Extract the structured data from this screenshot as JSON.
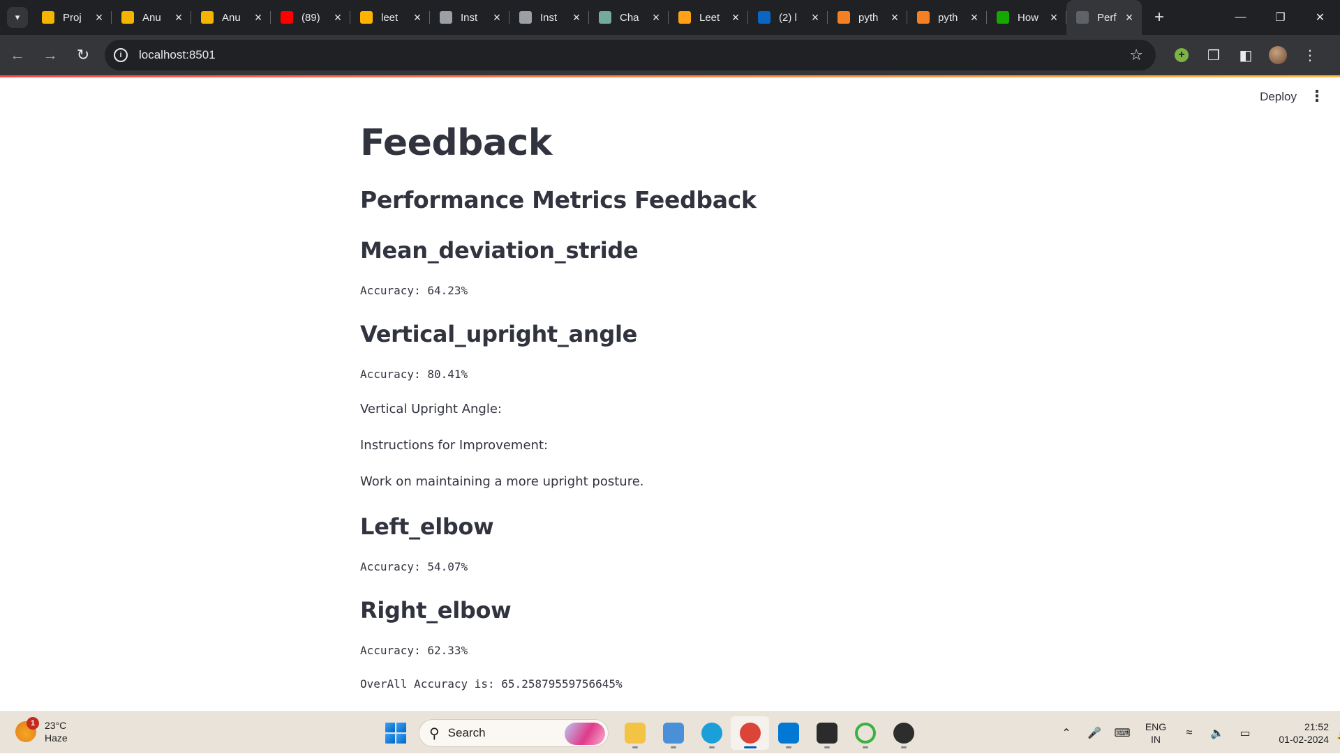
{
  "browser": {
    "tabs": [
      {
        "title": "Proj",
        "icon": "chart-bars-icon",
        "color": "#f4b400"
      },
      {
        "title": "Anu",
        "icon": "chart-bars-icon",
        "color": "#f4b400"
      },
      {
        "title": "Anu",
        "icon": "chart-bars-icon",
        "color": "#f4b400"
      },
      {
        "title": "(89)",
        "icon": "youtube-icon",
        "color": "#ff0000"
      },
      {
        "title": "leet",
        "icon": "hand-icon",
        "color": "#ffb300"
      },
      {
        "title": "Inst",
        "icon": "circle-c-icon",
        "color": "#9aa0a6"
      },
      {
        "title": "Inst",
        "icon": "circle-c-icon",
        "color": "#9aa0a6"
      },
      {
        "title": "Cha",
        "icon": "chatgpt-icon",
        "color": "#74aa9c"
      },
      {
        "title": "Leet",
        "icon": "leetcode-icon",
        "color": "#ffa116"
      },
      {
        "title": "(2) l",
        "icon": "linkedin-icon",
        "color": "#0a66c2"
      },
      {
        "title": "pyth",
        "icon": "stackoverflow-icon",
        "color": "#f48024"
      },
      {
        "title": "pyth",
        "icon": "stackoverflow-icon",
        "color": "#f48024"
      },
      {
        "title": "How",
        "icon": "upwork-icon",
        "color": "#14a800"
      },
      {
        "title": "Perf",
        "icon": "globe-icon",
        "color": "#5f6368"
      }
    ],
    "url": "localhost:8501"
  },
  "app": {
    "deploy_label": "Deploy",
    "title": "Feedback",
    "subtitle": "Performance Metrics Feedback",
    "metrics": {
      "mean_deviation_stride": {
        "name": "Mean_deviation_stride",
        "accuracy": "Accuracy: 64.23%"
      },
      "vertical_upright_angle": {
        "name": "Vertical_upright_angle",
        "accuracy": "Accuracy: 80.41%",
        "label": "Vertical Upright Angle:",
        "instructions_label": "Instructions for Improvement:",
        "instruction": "Work on maintaining a more upright posture."
      },
      "left_elbow": {
        "name": "Left_elbow",
        "accuracy": "Accuracy: 54.07%"
      },
      "right_elbow": {
        "name": "Right_elbow",
        "accuracy": "Accuracy: 62.33%"
      }
    },
    "overall": "OverAll Accuracy is: 65.25879559756645%"
  },
  "taskbar": {
    "weather": {
      "temp": "23°C",
      "condition": "Haze",
      "badge": "1"
    },
    "search_label": "Search",
    "apps": [
      {
        "name": "file-explorer-icon",
        "color": "#f3c443",
        "active": false
      },
      {
        "name": "notepad-icon",
        "color": "#4a90d9",
        "active": false
      },
      {
        "name": "edge-icon",
        "color": "#1a9fd9",
        "active": false
      },
      {
        "name": "chrome-icon",
        "color": "#db4437",
        "active": true
      },
      {
        "name": "vscode-icon",
        "color": "#0078d4",
        "active": false
      },
      {
        "name": "terminal-icon",
        "color": "#2b2b2b",
        "active": false
      },
      {
        "name": "loading-ring-icon",
        "color": "#3cb043",
        "active": false
      },
      {
        "name": "obs-icon",
        "color": "#2d2d2d",
        "active": false
      }
    ],
    "lang_top": "ENG",
    "lang_bottom": "IN",
    "time": "21:52",
    "date": "01-02-2024"
  }
}
